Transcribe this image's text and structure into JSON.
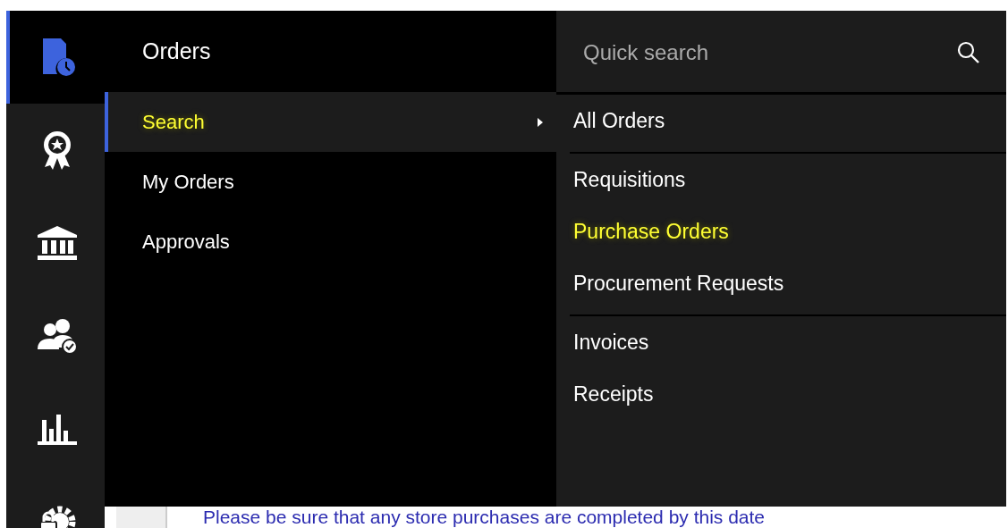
{
  "rail": {
    "items": [
      {
        "kind": "orders",
        "selected": true
      },
      {
        "kind": "award",
        "selected": false
      },
      {
        "kind": "bank",
        "selected": false
      },
      {
        "kind": "people",
        "selected": false
      },
      {
        "kind": "chart",
        "selected": false
      },
      {
        "kind": "gear",
        "selected": false
      }
    ]
  },
  "menu": {
    "title": "Orders",
    "items": [
      {
        "label": "Search",
        "selected": true,
        "highlighted": true,
        "submenu": true
      },
      {
        "label": "My Orders",
        "selected": false,
        "highlighted": false,
        "submenu": false
      },
      {
        "label": "Approvals",
        "selected": false,
        "highlighted": false,
        "submenu": false
      }
    ]
  },
  "submenu": {
    "search": {
      "placeholder": "Quick search"
    },
    "groups": [
      {
        "items": [
          {
            "label": "All Orders",
            "highlighted": false
          }
        ]
      },
      {
        "items": [
          {
            "label": "Requisitions",
            "highlighted": false
          },
          {
            "label": "Purchase Orders",
            "highlighted": true
          },
          {
            "label": "Procurement Requests",
            "highlighted": false
          }
        ]
      },
      {
        "items": [
          {
            "label": "Invoices",
            "highlighted": false
          },
          {
            "label": "Receipts",
            "highlighted": false
          }
        ]
      }
    ]
  },
  "notice": {
    "text": "Please be sure that any store purchases are completed by this date"
  }
}
